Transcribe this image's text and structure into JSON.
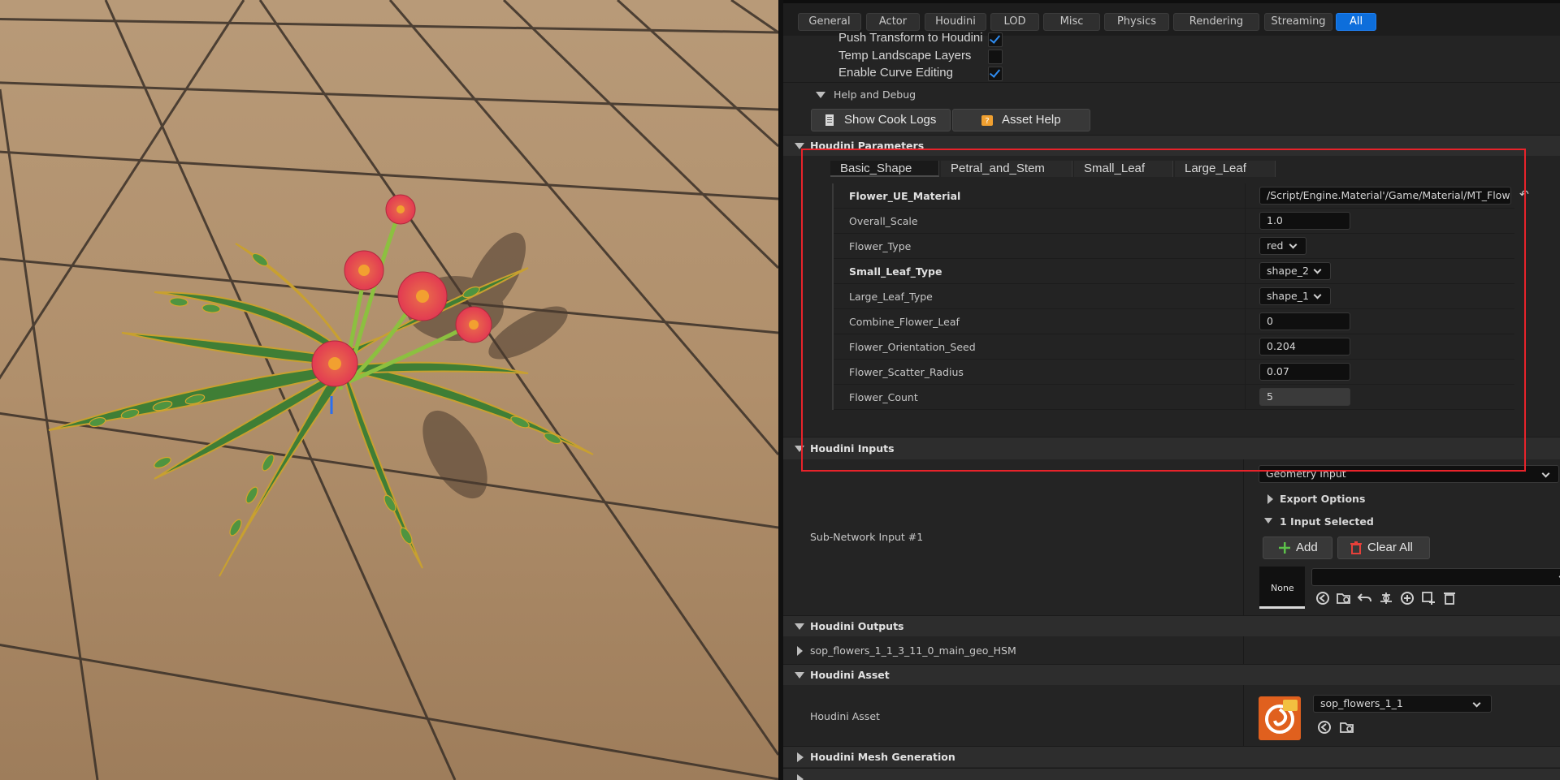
{
  "filter_tabs": [
    {
      "label": "General",
      "active": false
    },
    {
      "label": "Actor",
      "active": false
    },
    {
      "label": "Houdini",
      "active": false
    },
    {
      "label": "LOD",
      "active": false
    },
    {
      "label": "Misc",
      "active": false
    },
    {
      "label": "Physics",
      "active": false
    },
    {
      "label": "Rendering",
      "active": false
    },
    {
      "label": "Streaming",
      "active": false
    },
    {
      "label": "All",
      "active": true
    }
  ],
  "top_props": [
    {
      "label": "Push Transform to Houdini",
      "checked": true
    },
    {
      "label": "Temp Landscape Layers",
      "checked": false
    },
    {
      "label": "Enable Curve Editing",
      "checked": true
    }
  ],
  "help_debug": {
    "title": "Help and Debug",
    "show_cook_logs": "Show Cook Logs",
    "asset_help": "Asset Help"
  },
  "houdini_parameters": {
    "title": "Houdini Parameters",
    "tabs": [
      "Basic_Shape",
      "Petral_and_Stem",
      "Small_Leaf",
      "Large_Leaf"
    ],
    "rows": [
      {
        "label": "Flower_UE_Material",
        "bold": true,
        "kind": "text",
        "value": "/Script/Engine.Material'/Game/Material/MT_Flower"
      },
      {
        "label": "Overall_Scale",
        "bold": false,
        "kind": "text",
        "value": "1.0"
      },
      {
        "label": "Flower_Type",
        "bold": false,
        "kind": "dropdown",
        "value": "red"
      },
      {
        "label": "Small_Leaf_Type",
        "bold": true,
        "kind": "dropdown",
        "value": "shape_2"
      },
      {
        "label": "Large_Leaf_Type",
        "bold": false,
        "kind": "dropdown",
        "value": "shape_1"
      },
      {
        "label": "Combine_Flower_Leaf",
        "bold": false,
        "kind": "text",
        "value": "0"
      },
      {
        "label": "Flower_Orientation_Seed",
        "bold": false,
        "kind": "text",
        "value": "0.204"
      },
      {
        "label": "Flower_Scatter_Radius",
        "bold": false,
        "kind": "text",
        "value": "0.07"
      },
      {
        "label": "Flower_Count",
        "bold": false,
        "kind": "slider",
        "value": "5"
      }
    ]
  },
  "houdini_inputs": {
    "title": "Houdini Inputs",
    "input_label": "Sub-Network Input #1",
    "input_type": "Geometry Input",
    "export_options": "Export Options",
    "input_selected": "1 Input Selected",
    "add": "Add",
    "clear_all": "Clear All",
    "thumb_label": "None"
  },
  "houdini_outputs": {
    "title": "Houdini Outputs",
    "item": "sop_flowers_1_1_3_11_0_main_geo_HSM"
  },
  "houdini_asset": {
    "title": "Houdini Asset",
    "label": "Houdini Asset",
    "value": "sop_flowers_1_1"
  },
  "houdini_mesh_generation": {
    "title": "Houdini Mesh Generation"
  },
  "colors": {
    "accent": "#0d6edb",
    "highlight": "#e8232a",
    "checkmark": "#2f8cf0",
    "add_icon": "#5cc04a",
    "clear_icon": "#e5403a"
  }
}
